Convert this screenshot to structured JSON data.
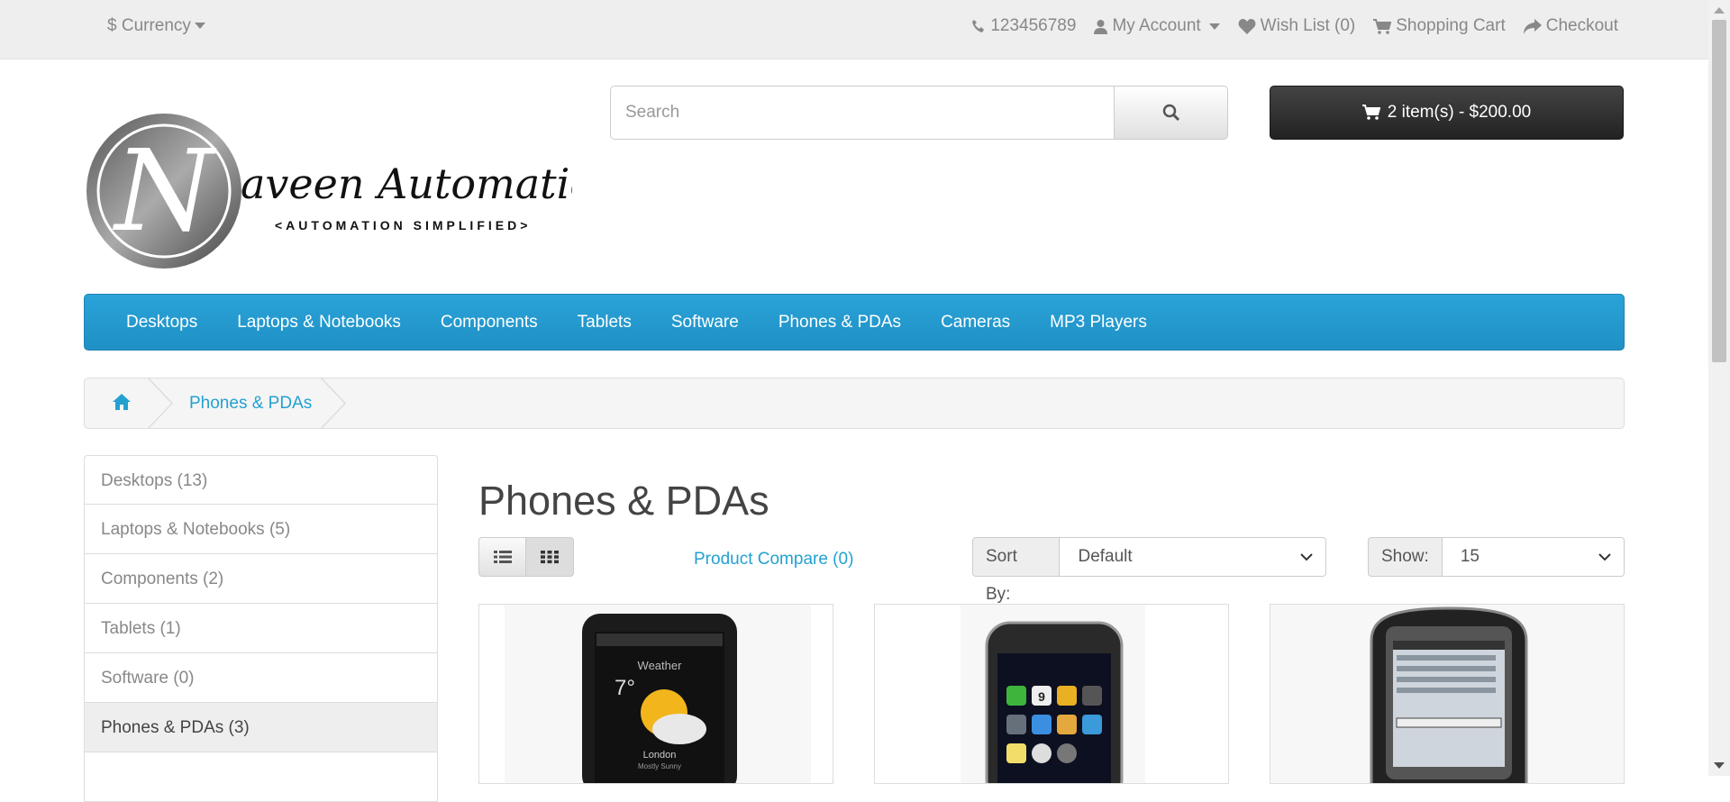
{
  "topbar": {
    "currency_label": "Currency",
    "phone": "123456789",
    "my_account": "My Account",
    "wishlist": "Wish List (0)",
    "shopping_cart": "Shopping Cart",
    "checkout": "Checkout"
  },
  "logo": {
    "initial": "N",
    "name": "aveen Automation Labs",
    "tagline": "<AUTOMATION SIMPLIFIED>"
  },
  "search": {
    "placeholder": "Search",
    "value": ""
  },
  "cart": {
    "label": "2 item(s) - $200.00"
  },
  "menu": [
    "Desktops",
    "Laptops & Notebooks",
    "Components",
    "Tablets",
    "Software",
    "Phones & PDAs",
    "Cameras",
    "MP3 Players"
  ],
  "breadcrumb": {
    "current": "Phones & PDAs"
  },
  "sidebar": [
    {
      "label": "Desktops (13)"
    },
    {
      "label": "Laptops & Notebooks (5)"
    },
    {
      "label": "Components (2)"
    },
    {
      "label": "Tablets (1)"
    },
    {
      "label": "Software (0)"
    },
    {
      "label": "Phones & PDAs (3)"
    }
  ],
  "page": {
    "title": "Phones & PDAs",
    "product_compare": "Product Compare (0)",
    "sort_label": "Sort By:",
    "sort_value": "Default",
    "show_label": "Show:",
    "show_value": "15"
  },
  "phone_screens": {
    "htc_time": "7°",
    "htc_weather": "Weather",
    "htc_city": "London",
    "htc_condition": "Mostly Sunny",
    "iphone_date": "9"
  },
  "colors": {
    "accent": "#23a1d1",
    "menu": "#229ac8",
    "dark": "#303030"
  }
}
